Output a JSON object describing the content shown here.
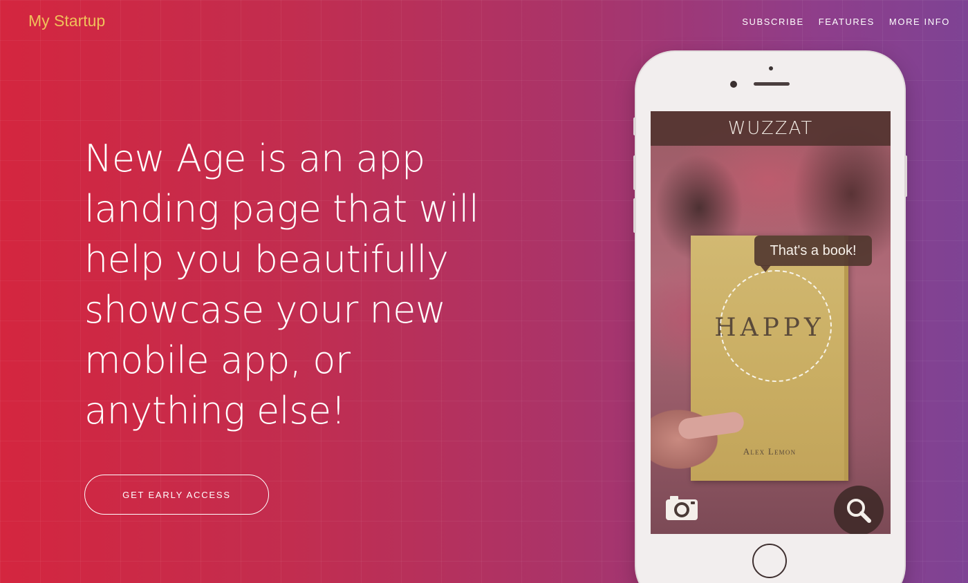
{
  "navbar": {
    "brand": "My Startup",
    "links": [
      "SUBSCRIBE",
      "FEATURES",
      "MORE INFO"
    ]
  },
  "hero": {
    "headline": "New Age is an app landing page that will help you beautifully showcase your new mobile app, or anything else!",
    "cta_label": "GET EARLY ACCESS"
  },
  "device_screen": {
    "app_title": "WUZZAT",
    "tooltip": "That's a book!",
    "book_title": "HAPPY",
    "book_author": "Alex Lemon",
    "icons": [
      "camera-icon",
      "search-icon"
    ]
  },
  "colors": {
    "gradient_start": "#d4263f",
    "gradient_end": "#7e4394",
    "brand": "#f0c05a"
  }
}
